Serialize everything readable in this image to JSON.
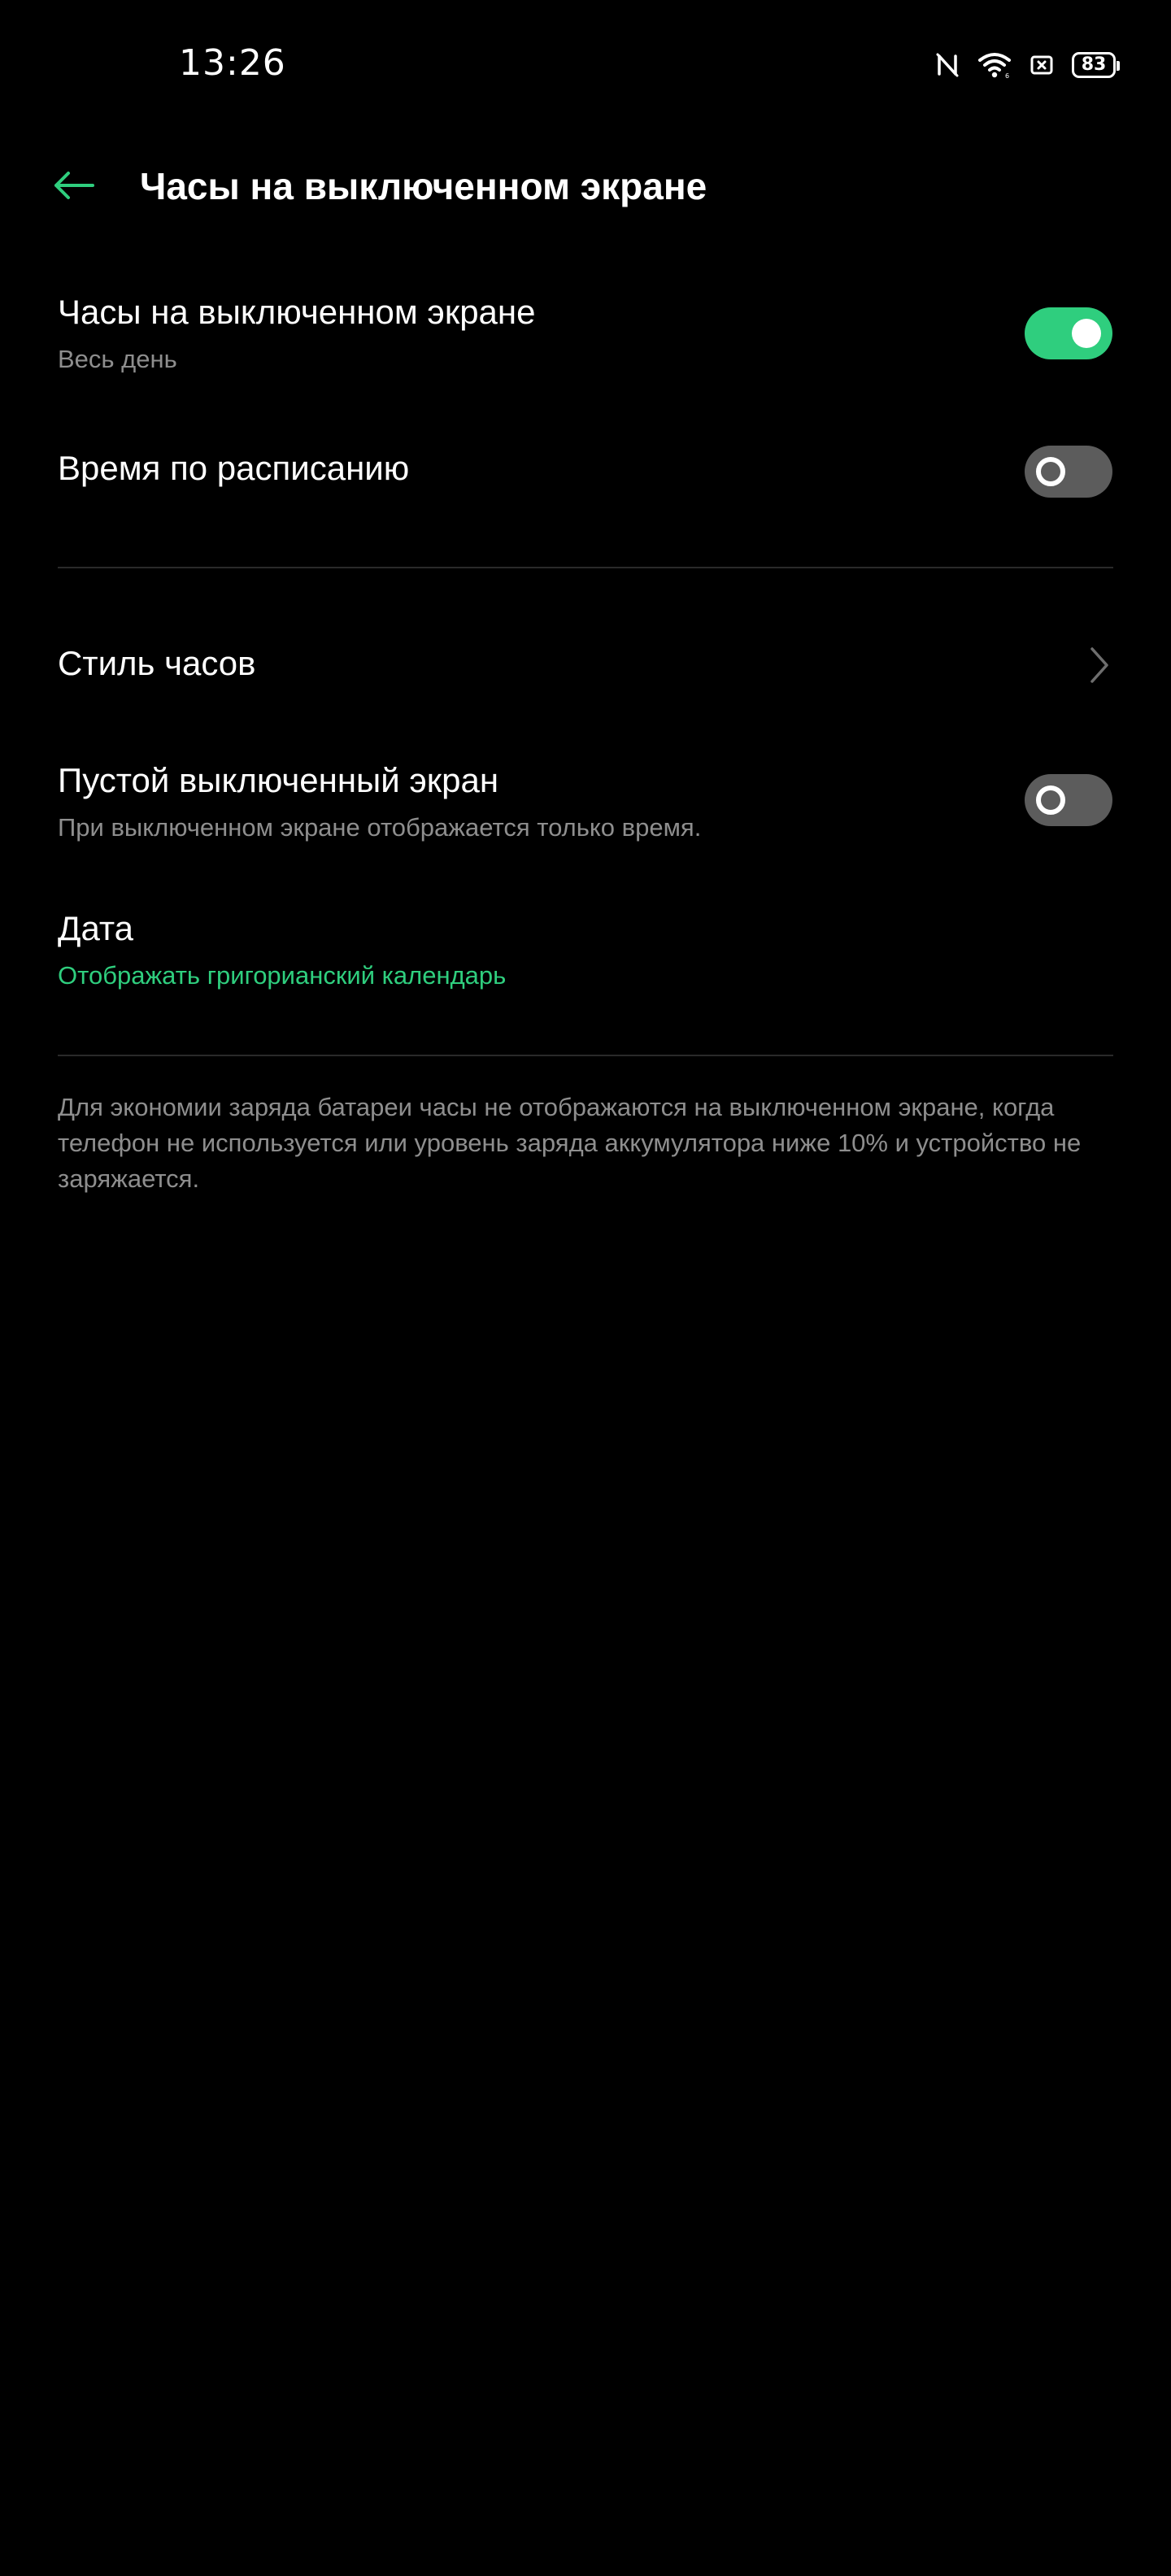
{
  "status_bar": {
    "time": "13:26",
    "icons": [
      "nfc-off-icon",
      "wifi-icon",
      "sim-x-icon",
      "battery-icon"
    ],
    "battery_level": "83"
  },
  "header": {
    "title": "Часы на выключенном экране",
    "back_icon": "arrow-left-icon"
  },
  "settings": {
    "aod": {
      "title": "Часы на выключенном экране",
      "subtitle": "Весь день",
      "enabled": true
    },
    "schedule": {
      "title": "Время по расписанию",
      "enabled": false
    },
    "clock_style": {
      "title": "Стиль часов",
      "icon": "chevron-right-icon"
    },
    "blank_screen": {
      "title": "Пустой выключенный экран",
      "subtitle": "При выключенном экране отображается только время.",
      "enabled": false
    },
    "date": {
      "title": "Дата",
      "value": "Отображать григорианский календарь"
    }
  },
  "footnote": "Для экономии заряда батареи часы не отображаются на выключенном экране, когда телефон не используется или уровень заряда аккумулятора ниже 10% и устройство не заряжается.",
  "colors": {
    "accent": "#2fce7e",
    "background": "#000000",
    "secondary_text": "#8e8e8e",
    "toggle_off": "#5c5c5c"
  }
}
